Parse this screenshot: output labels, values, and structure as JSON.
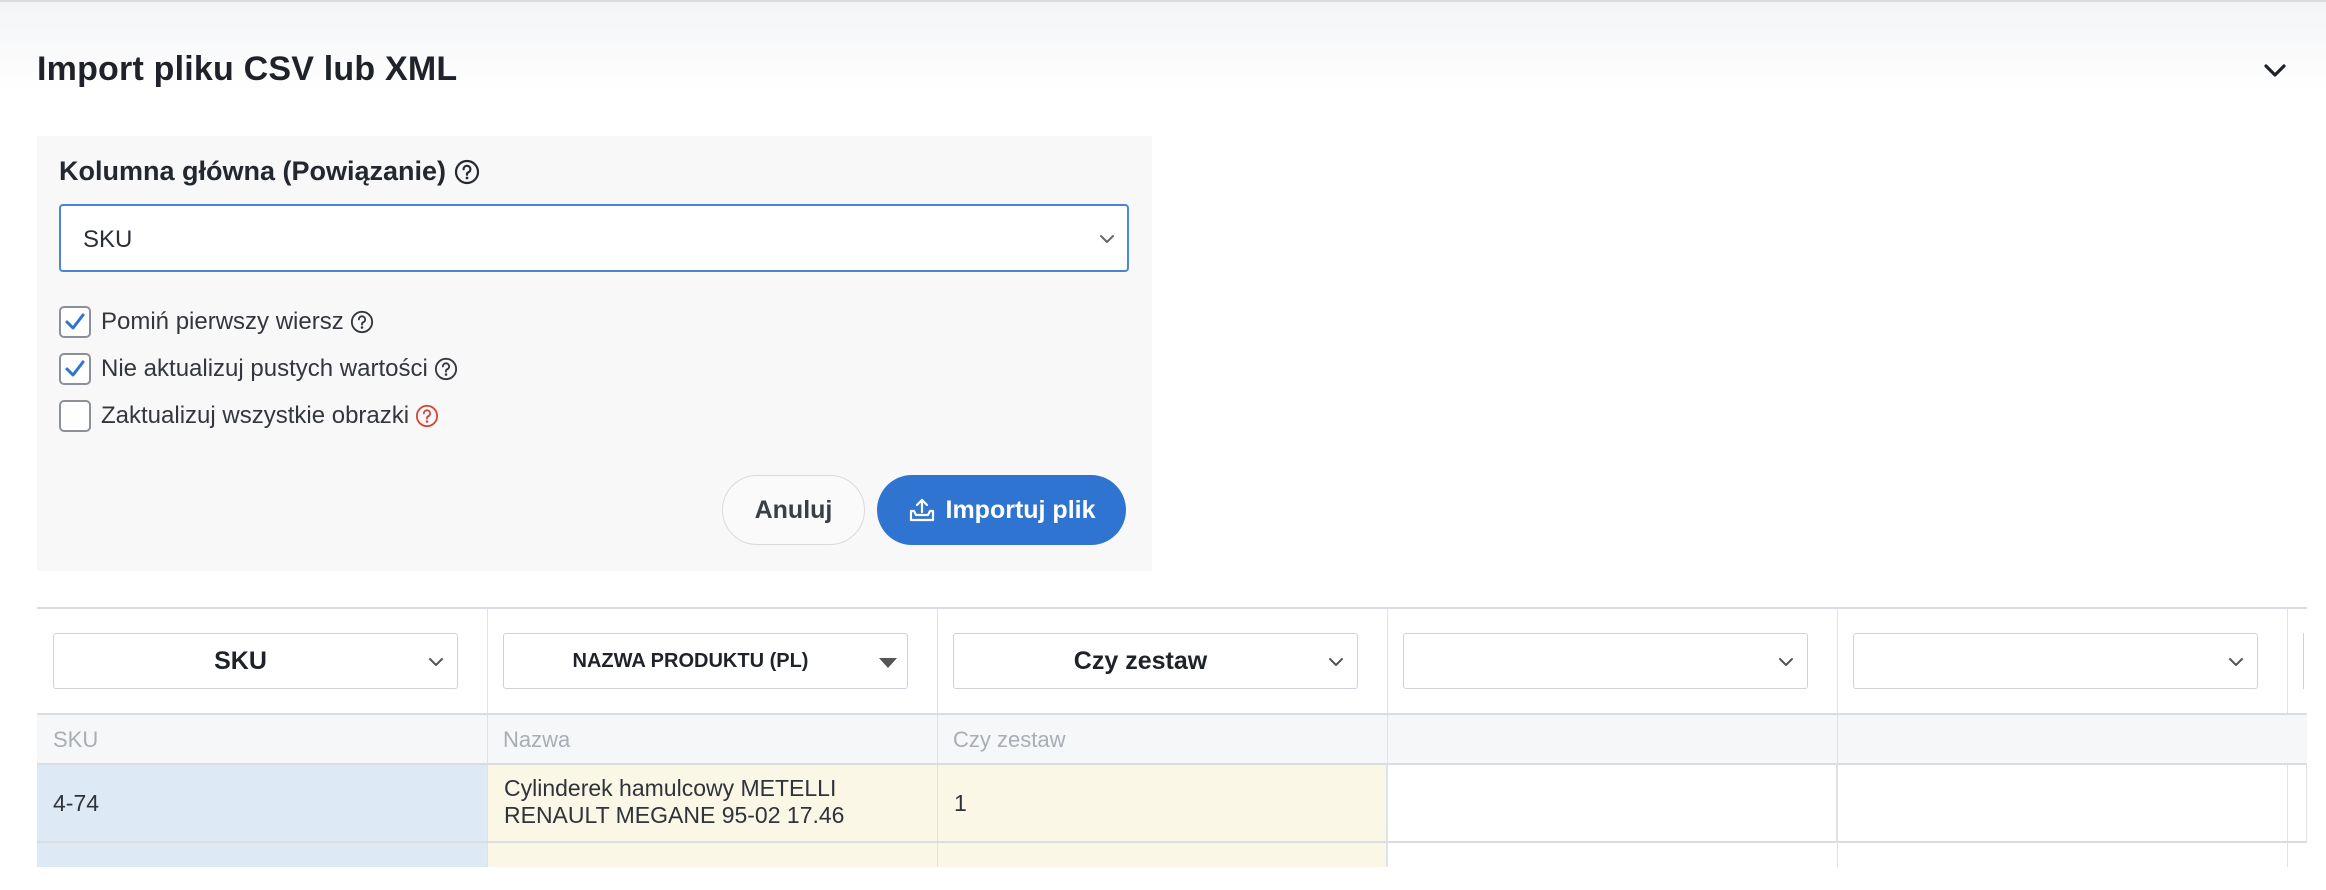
{
  "panel": {
    "title": "Import pliku CSV lub XML"
  },
  "settings": {
    "main_column_label": "Kolumna główna (Powiązanie)",
    "main_column_value": "SKU",
    "checkboxes": [
      {
        "label": "Pomiń pierwszy wiersz",
        "checked": true,
        "help_color": "#33373d"
      },
      {
        "label": "Nie aktualizuj pustych wartości",
        "checked": true,
        "help_color": "#33373d"
      },
      {
        "label": "Zaktualizuj wszystkie obrazki",
        "checked": false,
        "help_color": "#d24a3a"
      }
    ],
    "cancel_label": "Anuluj",
    "import_label": "Importuj plik"
  },
  "mapping": {
    "columns": [
      {
        "select_label": "SKU",
        "header": "SKU",
        "cell": "4-74",
        "cell_bg": "#dde9f5"
      },
      {
        "select_label": "NAZWA PRODUKTU (PL)",
        "header": "Nazwa",
        "cell_line1": "Cylinderek hamulcowy METELLI",
        "cell_line2": "RENAULT MEGANE 95-02 17.46",
        "cell_bg": "#faf7e6"
      },
      {
        "select_label": "Czy zestaw",
        "header": "Czy zestaw",
        "cell": "1",
        "cell_bg": "#faf7e6"
      },
      {
        "select_label": "",
        "header": "",
        "cell": "",
        "cell_bg": "#ffffff"
      },
      {
        "select_label": "",
        "header": "",
        "cell": "",
        "cell_bg": "#ffffff"
      }
    ]
  },
  "colors": {
    "accent": "#2f74d0",
    "select_border": "#4a86d8",
    "check": "#2f74d0"
  },
  "icons": {
    "collapse": "chevron-down-icon",
    "help": "question-circle-icon",
    "import": "upload-tray-icon"
  }
}
